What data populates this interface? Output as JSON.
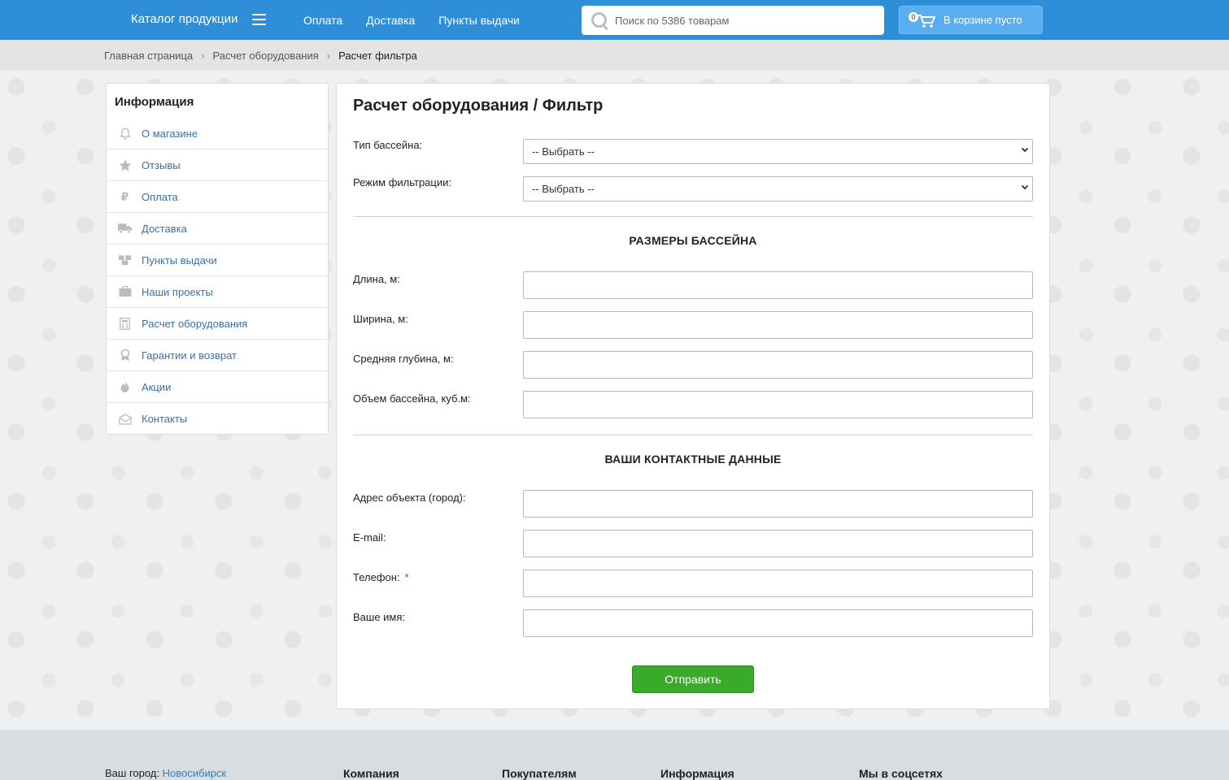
{
  "header": {
    "catalog_label": "Каталог продукции",
    "nav": [
      "Оплата",
      "Доставка",
      "Пункты выдачи"
    ],
    "search_placeholder": "Поиск по 5386 товарам",
    "cart_count": "0",
    "cart_label": "В корзине пусто"
  },
  "breadcrumb": {
    "items": [
      "Главная страница",
      "Расчет оборудования"
    ],
    "separator": "›",
    "current": "Расчет фильтра"
  },
  "sidebar": {
    "title": "Информация",
    "items": [
      {
        "label": "О магазине",
        "icon": "bell-icon"
      },
      {
        "label": "Отзывы",
        "icon": "star-icon"
      },
      {
        "label": "Оплата",
        "icon": "ruble-icon"
      },
      {
        "label": "Доставка",
        "icon": "truck-icon"
      },
      {
        "label": "Пункты выдачи",
        "icon": "boxes-icon"
      },
      {
        "label": "Наши проекты",
        "icon": "briefcase-icon"
      },
      {
        "label": "Расчет оборудования",
        "icon": "calculator-icon"
      },
      {
        "label": "Гарантии и возврат",
        "icon": "award-icon"
      },
      {
        "label": "Акции",
        "icon": "fire-icon"
      },
      {
        "label": "Контакты",
        "icon": "envelope-icon"
      }
    ]
  },
  "form": {
    "title": "Расчет оборудования / Фильтр",
    "pool_type_label": "Тип бассейна:",
    "pool_type_value": "-- Выбрать --",
    "filter_mode_label": "Режим фильтрации:",
    "filter_mode_value": "-- Выбрать --",
    "section_sizes": "РАЗМЕРЫ БАССЕЙНА",
    "length_label": "Длина, м:",
    "width_label": "Ширина, м:",
    "depth_label": "Средняя глубина, м:",
    "volume_label": "Объем бассейна, куб.м:",
    "section_contacts": "ВАШИ КОНТАКТНЫЕ ДАННЫЕ",
    "address_label": "Адрес объекта (город):",
    "email_label": "E-mail:",
    "phone_label": "Телефон:",
    "required_mark": "*",
    "name_label": "Ваше имя:",
    "submit_label": "Отправить"
  },
  "footer": {
    "city_label": "Ваш город:",
    "city_value": "Новосибирск",
    "columns": [
      "Компания",
      "Покупателям",
      "Информация",
      "Мы в соцсетях"
    ]
  },
  "colors": {
    "header_bg": "#2e8fd8",
    "link": "#3a6fa8",
    "submit_bg": "#3aaa2a",
    "required": "#e02424"
  }
}
